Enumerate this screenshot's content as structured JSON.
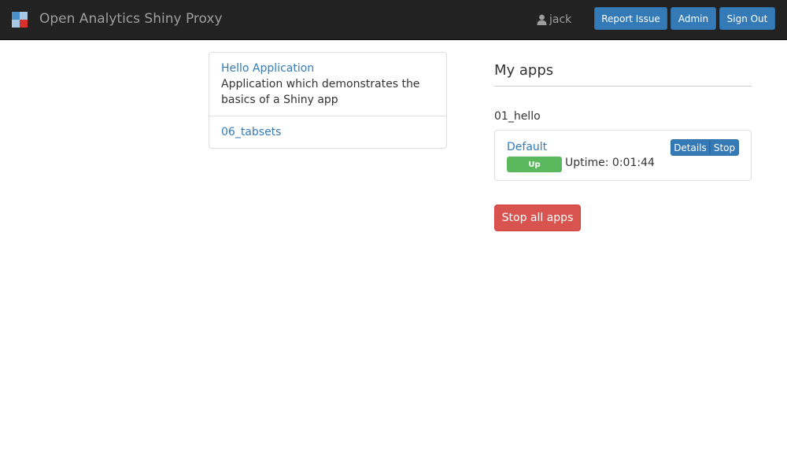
{
  "navbar": {
    "brand_title": "Open Analytics Shiny Proxy",
    "logo_icon": "shinyproxy-logo-icon",
    "user_icon": "user-icon",
    "username": "jack",
    "report_issue_label": "Report Issue",
    "admin_label": "Admin",
    "sign_out_label": "Sign Out"
  },
  "app_list": {
    "items": [
      {
        "title": "Hello Application",
        "description": "Application which demonstrates the basics of a Shiny app"
      },
      {
        "title": "06_tabsets"
      }
    ]
  },
  "my_apps": {
    "heading": "My apps",
    "groups": [
      {
        "name": "01_hello",
        "instances": [
          {
            "name": "Default",
            "status": "Up",
            "uptime": "Uptime: 0:01:44",
            "details_label": "Details",
            "stop_label": "Stop"
          }
        ]
      }
    ],
    "stop_all_label": "Stop all apps"
  },
  "colors": {
    "navbar_bg": "#222222",
    "primary": "#337ab7",
    "success": "#5cb85c",
    "danger": "#d9534f"
  }
}
